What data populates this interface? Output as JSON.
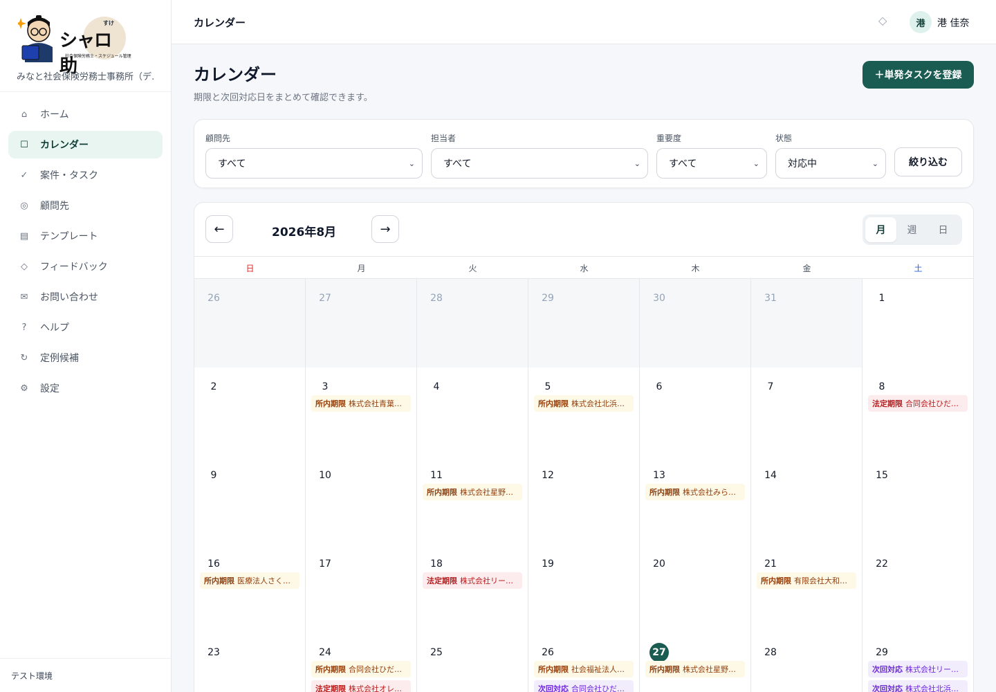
{
  "sidebar": {
    "logo": {
      "wordmark": "シャロ助",
      "ruby": "すけ",
      "tagline": "社会保険労務士・スケジュール管理"
    },
    "office_name": "みなと社会保険労務士事務所（デ…",
    "items": [
      {
        "label": "ホーム",
        "icon": "⌂"
      },
      {
        "label": "カレンダー",
        "icon": "☐"
      },
      {
        "label": "案件・タスク",
        "icon": "✓"
      },
      {
        "label": "顧問先",
        "icon": "◎"
      },
      {
        "label": "テンプレート",
        "icon": "▤"
      },
      {
        "label": "フィードバック",
        "icon": "◇"
      },
      {
        "label": "お問い合わせ",
        "icon": "✉"
      },
      {
        "label": "ヘルプ",
        "icon": "?"
      },
      {
        "label": "定例候補",
        "icon": "↻"
      },
      {
        "label": "設定",
        "icon": "⚙"
      }
    ],
    "footer": "テスト環境"
  },
  "topbar": {
    "title": "カレンダー",
    "notif_icon": "◇",
    "avatar": "港",
    "user_name": "港 佳奈"
  },
  "page": {
    "title": "カレンダー",
    "subtitle": "期限と次回対応日をまとめて確認できます。",
    "add_button": "＋単発タスクを登録"
  },
  "filters": {
    "client": {
      "label": "顧問先",
      "value": "すべて"
    },
    "assignee": {
      "label": "担当者",
      "value": "すべて"
    },
    "priority": {
      "label": "重要度",
      "value": "すべて"
    },
    "status": {
      "label": "状態",
      "value": "対応中"
    },
    "apply_button": "絞り込む",
    "chevron": "⌄"
  },
  "calendar": {
    "month_label": "2026年8月",
    "prev": "←",
    "next": "→",
    "views": [
      "月",
      "週",
      "日"
    ],
    "active_view": "月",
    "weekdays": [
      "日",
      "月",
      "火",
      "水",
      "木",
      "金",
      "土"
    ],
    "today": "27",
    "weeks": [
      [
        {
          "d": "26",
          "other": true,
          "events": []
        },
        {
          "d": "27",
          "other": true,
          "events": []
        },
        {
          "d": "28",
          "other": true,
          "events": []
        },
        {
          "d": "29",
          "other": true,
          "events": []
        },
        {
          "d": "30",
          "other": true,
          "events": []
        },
        {
          "d": "31",
          "other": true,
          "events": []
        },
        {
          "d": "1",
          "events": []
        }
      ],
      [
        {
          "d": "2",
          "events": []
        },
        {
          "d": "3",
          "events": [
            {
              "type": "internal",
              "kind": "所内期限",
              "text": "株式会社青葉…"
            }
          ]
        },
        {
          "d": "4",
          "events": []
        },
        {
          "d": "5",
          "events": [
            {
              "type": "internal",
              "kind": "所内期限",
              "text": "株式会社北浜…"
            }
          ]
        },
        {
          "d": "6",
          "events": []
        },
        {
          "d": "7",
          "events": []
        },
        {
          "d": "8",
          "events": [
            {
              "type": "legal",
              "kind": "法定期限",
              "text": "合同会社ひだ…"
            }
          ]
        }
      ],
      [
        {
          "d": "9",
          "events": []
        },
        {
          "d": "10",
          "events": []
        },
        {
          "d": "11",
          "events": [
            {
              "type": "internal",
              "kind": "所内期限",
              "text": "株式会社星野…"
            }
          ]
        },
        {
          "d": "12",
          "events": []
        },
        {
          "d": "13",
          "events": [
            {
              "type": "internal",
              "kind": "所内期限",
              "text": "株式会社みら…"
            }
          ]
        },
        {
          "d": "14",
          "events": []
        },
        {
          "d": "15",
          "events": []
        }
      ],
      [
        {
          "d": "16",
          "events": [
            {
              "type": "internal",
              "kind": "所内期限",
              "text": "医療法人さく…"
            }
          ]
        },
        {
          "d": "17",
          "events": []
        },
        {
          "d": "18",
          "events": [
            {
              "type": "legal",
              "kind": "法定期限",
              "text": "株式会社リー…"
            }
          ]
        },
        {
          "d": "19",
          "events": []
        },
        {
          "d": "20",
          "events": []
        },
        {
          "d": "21",
          "events": [
            {
              "type": "internal",
              "kind": "所内期限",
              "text": "有限会社大和…"
            }
          ]
        },
        {
          "d": "22",
          "events": []
        }
      ],
      [
        {
          "d": "23",
          "events": []
        },
        {
          "d": "24",
          "events": [
            {
              "type": "internal",
              "kind": "所内期限",
              "text": "合同会社ひだ…"
            },
            {
              "type": "legal",
              "kind": "法定期限",
              "text": "株式会社オレ…"
            }
          ]
        },
        {
          "d": "25",
          "events": []
        },
        {
          "d": "26",
          "events": [
            {
              "type": "internal",
              "kind": "所内期限",
              "text": "社会福祉法人…"
            },
            {
              "type": "next",
              "kind": "次回対応",
              "text": "合同会社ひだ…"
            }
          ]
        },
        {
          "d": "27",
          "today": true,
          "events": [
            {
              "type": "internal",
              "kind": "所内期限",
              "text": "株式会社星野…"
            }
          ]
        },
        {
          "d": "28",
          "events": []
        },
        {
          "d": "29",
          "events": [
            {
              "type": "next",
              "kind": "次回対応",
              "text": "株式会社リー…"
            },
            {
              "type": "next",
              "kind": "次回対応",
              "text": "株式会社北浜…"
            }
          ]
        }
      ]
    ]
  }
}
